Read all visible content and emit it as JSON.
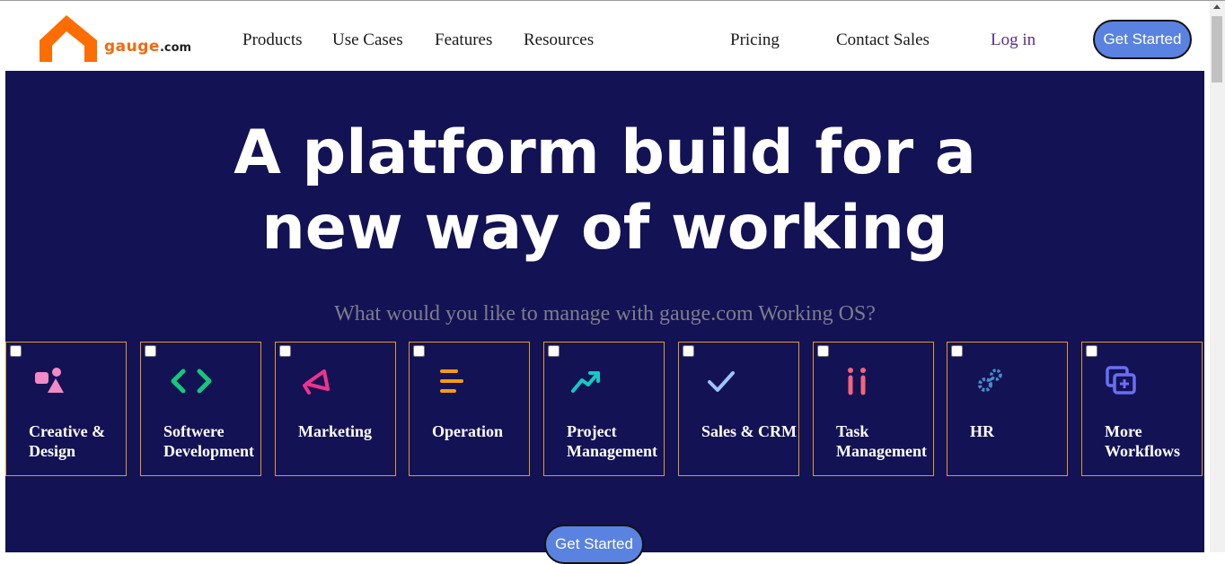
{
  "brand": {
    "name": "gauge",
    "tld": ".com",
    "color": "#f06a0f"
  },
  "nav": {
    "products": "Products",
    "use_cases": "Use Cases",
    "features": "Features",
    "resources": "Resources",
    "pricing": "Pricing",
    "contact_sales": "Contact Sales",
    "login": "Log in",
    "get_started": "Get Started"
  },
  "hero": {
    "title_line1": "A platform build for a",
    "title_line2": "new way of working",
    "subtitle": "What would you like to manage with gauge.com Working OS?",
    "get_started": "Get Started",
    "background": "#131255"
  },
  "workflows": [
    {
      "label": "Creative & Design",
      "icon": "shapes-icon",
      "checked": false
    },
    {
      "label": "Softwere Development",
      "icon": "code-icon",
      "checked": false
    },
    {
      "label": "Marketing",
      "icon": "megaphone-icon",
      "checked": false
    },
    {
      "label": "Operation",
      "icon": "lines-icon",
      "checked": false
    },
    {
      "label": "Project Management",
      "icon": "trend-icon",
      "checked": false
    },
    {
      "label": "Sales & CRM",
      "icon": "check-icon",
      "checked": false
    },
    {
      "label": "Task Management",
      "icon": "task-icon",
      "checked": false
    },
    {
      "label": "HR",
      "icon": "gears-icon",
      "checked": false
    },
    {
      "label": "More Workflows",
      "icon": "add-window-icon",
      "checked": false
    }
  ]
}
